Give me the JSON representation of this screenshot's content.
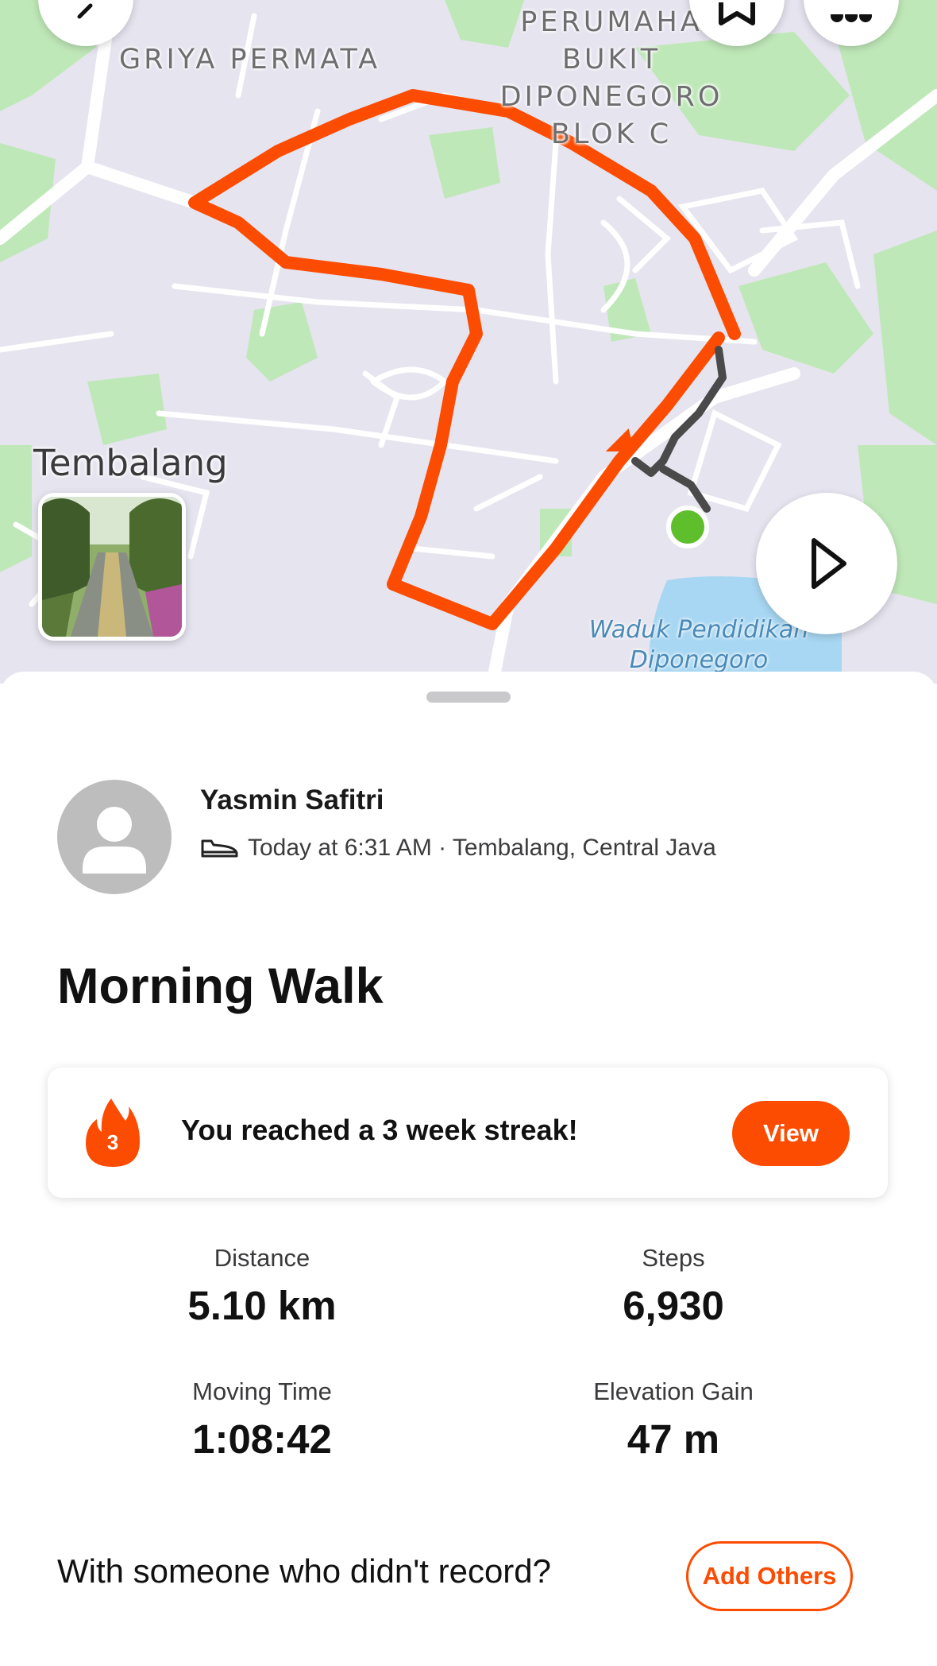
{
  "map": {
    "labels": {
      "griya_permata": "GRIYA PERMATA",
      "perumahan_line1": "PERUMAHA",
      "perumahan_line2": "BUKIT",
      "perumahan_line3": "DIPONEGORO",
      "perumahan_line4": "BLOK C",
      "tembalang": "Tembalang",
      "waduk_line1": "Waduk Pendidikan",
      "waduk_line2": "Diponegoro"
    },
    "route_color": "#fc4c02",
    "start_marker_color": "#5fbe2c",
    "controls": {
      "back_icon": "chevron-left-icon",
      "bookmark_icon": "bookmark-icon",
      "more_icon": "more-horizontal-icon",
      "play_icon": "play-icon"
    }
  },
  "activity": {
    "athlete_name": "Yasmin Safitri",
    "activity_icon": "walking-shoe-icon",
    "meta": "Today at 6:31 AM · Tembalang, Central Java",
    "title": "Morning Walk"
  },
  "streak": {
    "count": "3",
    "message": "You reached a 3 week streak!",
    "button_label": "View"
  },
  "stats": {
    "distance": {
      "label": "Distance",
      "value": "5.10 km"
    },
    "steps": {
      "label": "Steps",
      "value": "6,930"
    },
    "moving_time": {
      "label": "Moving Time",
      "value": "1:08:42"
    },
    "elevation_gain": {
      "label": "Elevation Gain",
      "value": "47 m"
    }
  },
  "add_others": {
    "prompt": "With someone who didn't record?",
    "button_label": "Add Others"
  },
  "colors": {
    "accent": "#fc4c02",
    "park_green": "#b9e6b3"
  }
}
